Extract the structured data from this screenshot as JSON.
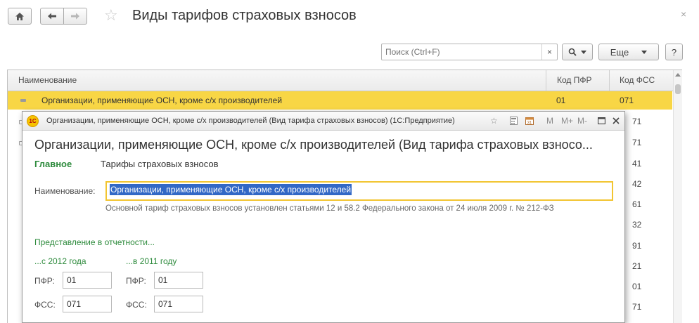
{
  "window": {
    "title": "Виды тарифов страховых взносов"
  },
  "toolbar": {
    "search_placeholder": "Поиск (Ctrl+F)",
    "search_clear": "×",
    "more_label": "Еще",
    "help_label": "?"
  },
  "table": {
    "columns": [
      "Наименование",
      "Код ПФР",
      "Код ФСС"
    ],
    "selected_row": {
      "name": "Организации, применяющие ОСН, кроме с/х производителей",
      "pfr": "01",
      "fss": "071"
    },
    "fss_partial": [
      "71",
      "71",
      "41",
      "42",
      "61",
      "32",
      "91",
      "21",
      "01",
      "71"
    ]
  },
  "dialog": {
    "window_title": "Организации, применяющие ОСН, кроме с/х производителей (Вид тарифа страховых взносов)  (1С:Предприятие)",
    "title": "Организации, применяющие ОСН, кроме с/х производителей (Вид тарифа страховых взносо...",
    "tabs": [
      "Главное",
      "Тарифы страховых взносов"
    ],
    "name_label": "Наименование:",
    "name_value": "Организации, применяющие ОСН, кроме с/х производителей",
    "hint": "Основной тариф страховых взносов установлен статьями 12 и 58.2 Федерального закона от 24 июля 2009 г. № 212-ФЗ",
    "reporting_header": "Представление в отчетности...",
    "from_2012": {
      "header": "...с 2012 года",
      "pfr_label": "ПФР:",
      "pfr_value": "01",
      "fss_label": "ФСС:",
      "fss_value": "071"
    },
    "in_2011": {
      "header": "...в 2011 году",
      "pfr_label": "ПФР:",
      "pfr_value": "01",
      "fss_label": "ФСС:",
      "fss_value": "071"
    },
    "titlebar_m": "M",
    "titlebar_mplus": "M+",
    "titlebar_mminus": "M-"
  },
  "colors": {
    "selection": "#f8d645",
    "accent_green": "#2e8b3d",
    "text_selection": "#3268c6"
  }
}
